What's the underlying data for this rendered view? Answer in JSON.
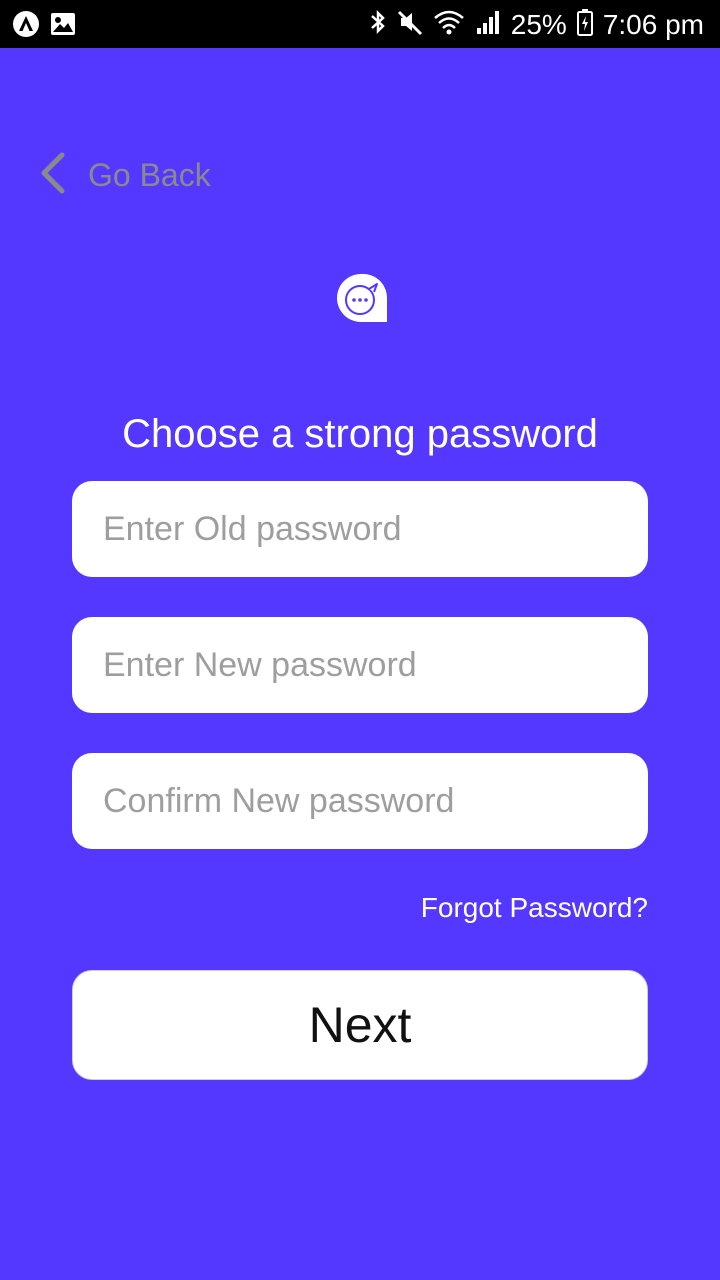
{
  "status_bar": {
    "battery_percent": "25%",
    "time": "7:06 pm",
    "left_icons": [
      "expo-icon",
      "image-icon"
    ],
    "right_icons": [
      "bluetooth-icon",
      "mute-icon",
      "wifi-icon",
      "signal-icon",
      "battery-charging-icon"
    ]
  },
  "header": {
    "back_label": "Go Back",
    "back_icon": "chevron-left-icon",
    "logo_icon": "chat-bubble-icon"
  },
  "main": {
    "title": "Choose a strong password",
    "old_password_placeholder": "Enter Old password",
    "new_password_placeholder": "Enter New password",
    "confirm_password_placeholder": "Confirm New password",
    "forgot_label": "Forgot Password?",
    "next_label": "Next"
  },
  "colors": {
    "background": "#5438FF",
    "status_bar": "#000000",
    "field_bg": "#FFFFFF",
    "placeholder": "#9E9E9E",
    "back_text": "#8A8A8A"
  }
}
